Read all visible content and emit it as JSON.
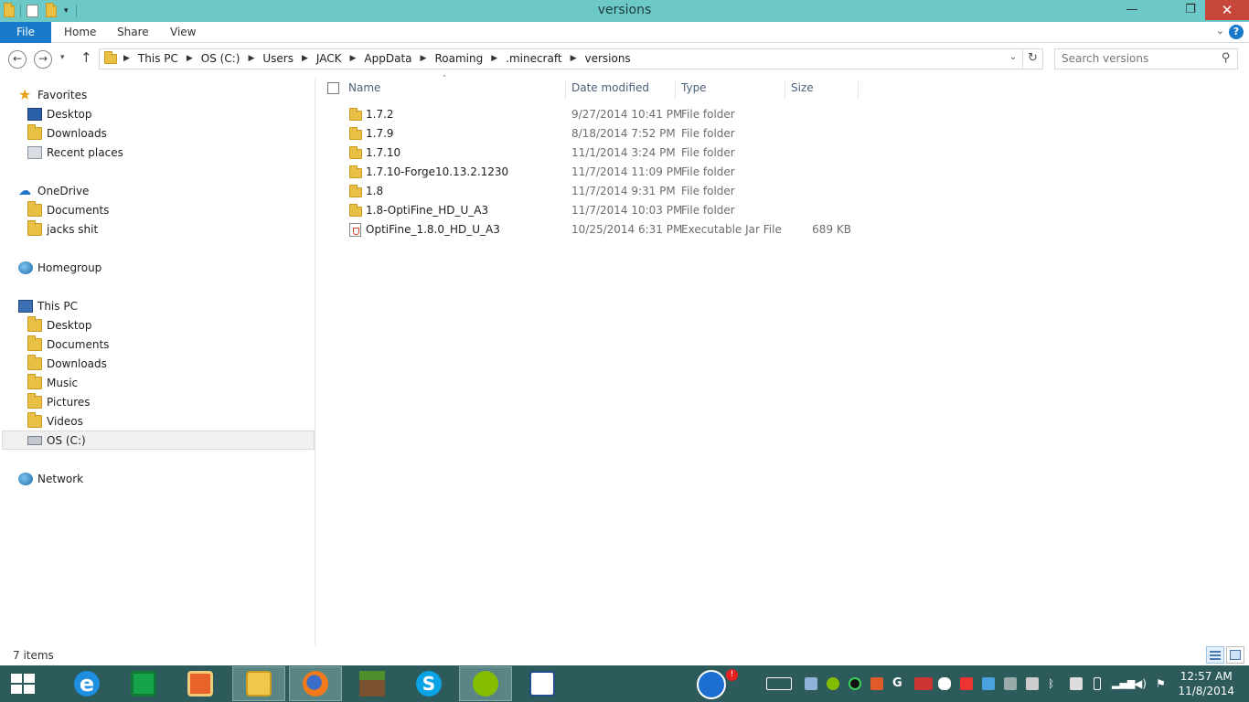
{
  "window": {
    "title": "versions"
  },
  "ribbon": {
    "tabs": [
      "File",
      "Home",
      "Share",
      "View"
    ]
  },
  "address": {
    "crumbs": [
      "This PC",
      "OS (C:)",
      "Users",
      "JACK",
      "AppData",
      "Roaming",
      ".minecraft",
      "versions"
    ]
  },
  "search": {
    "placeholder": "Search versions"
  },
  "sidebar": {
    "favorites": {
      "label": "Favorites",
      "items": [
        "Desktop",
        "Downloads",
        "Recent places"
      ]
    },
    "onedrive": {
      "label": "OneDrive",
      "items": [
        "Documents",
        "jacks shit"
      ]
    },
    "homegroup": {
      "label": "Homegroup"
    },
    "thispc": {
      "label": "This PC",
      "items": [
        "Desktop",
        "Documents",
        "Downloads",
        "Music",
        "Pictures",
        "Videos",
        "OS (C:)"
      ],
      "selected": "OS (C:)"
    },
    "network": {
      "label": "Network"
    }
  },
  "columns": {
    "name": "Name",
    "date": "Date modified",
    "type": "Type",
    "size": "Size"
  },
  "files": [
    {
      "name": "1.7.2",
      "date": "9/27/2014 10:41 PM",
      "type": "File folder",
      "size": "",
      "icon": "folder-icon"
    },
    {
      "name": "1.7.9",
      "date": "8/18/2014 7:52 PM",
      "type": "File folder",
      "size": "",
      "icon": "folder-icon"
    },
    {
      "name": "1.7.10",
      "date": "11/1/2014 3:24 PM",
      "type": "File folder",
      "size": "",
      "icon": "folder-icon"
    },
    {
      "name": "1.7.10-Forge10.13.2.1230",
      "date": "11/7/2014 11:09 PM",
      "type": "File folder",
      "size": "",
      "icon": "folder-icon"
    },
    {
      "name": "1.8",
      "date": "11/7/2014 9:31 PM",
      "type": "File folder",
      "size": "",
      "icon": "folder-icon"
    },
    {
      "name": "1.8-OptiFine_HD_U_A3",
      "date": "11/7/2014 10:03 PM",
      "type": "File folder",
      "size": "",
      "icon": "folder-icon"
    },
    {
      "name": "OptiFine_1.8.0_HD_U_A3",
      "date": "10/25/2014 6:31 PM",
      "type": "Executable Jar File",
      "size": "689 KB",
      "icon": "jar-file-icon"
    }
  ],
  "status": {
    "item_count": "7 items"
  },
  "taskbar": {
    "apps": [
      "start-icon",
      "internet-explorer-icon",
      "store-icon",
      "office-icon",
      "file-explorer-icon",
      "firefox-icon",
      "minecraft-icon",
      "skype-icon",
      "spotify-icon",
      "paint-icon"
    ],
    "clock": {
      "time": "12:57 AM",
      "date": "11/8/2014"
    }
  },
  "colors": {
    "titlebar": "#6cc9c8",
    "accent": "#1979ca",
    "taskbar": "#2d5a5a",
    "close": "#c7463a"
  }
}
